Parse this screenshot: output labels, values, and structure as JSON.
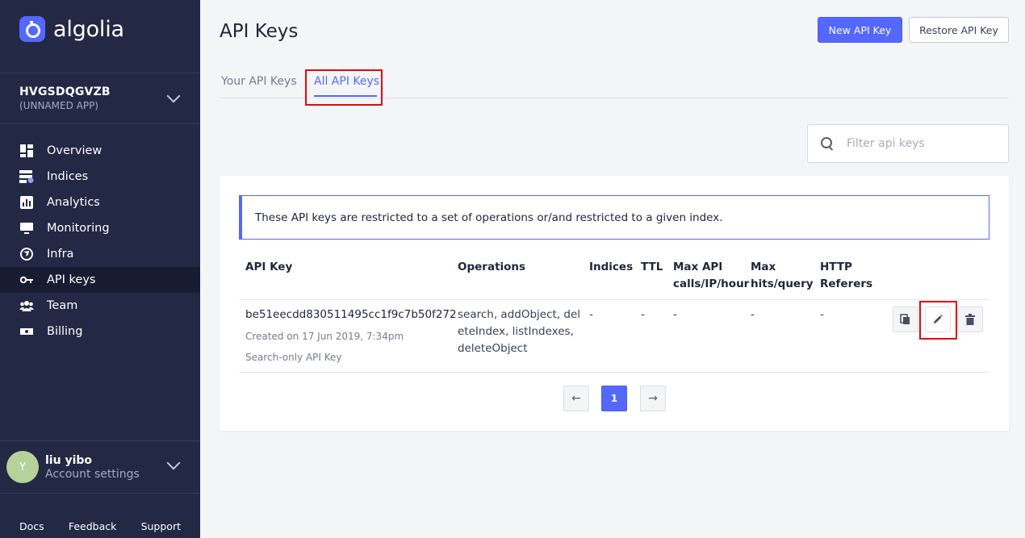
{
  "brand": {
    "name": "algolia",
    "accent": "#5468ff",
    "sidebar_bg": "#232844"
  },
  "app": {
    "id": "HVGSDQGVZB",
    "name": "(UNNAMED APP)"
  },
  "nav": [
    {
      "label": "Overview",
      "icon": "overview-icon"
    },
    {
      "label": "Indices",
      "icon": "indices-icon"
    },
    {
      "label": "Analytics",
      "icon": "analytics-icon"
    },
    {
      "label": "Monitoring",
      "icon": "monitoring-icon"
    },
    {
      "label": "Infra",
      "icon": "infra-icon"
    },
    {
      "label": "API keys",
      "icon": "key-icon",
      "active": true
    },
    {
      "label": "Team",
      "icon": "team-icon"
    },
    {
      "label": "Billing",
      "icon": "billing-icon"
    }
  ],
  "user": {
    "initial": "Y",
    "name": "liu yibo",
    "subtitle": "Account settings"
  },
  "footer": {
    "docs": "Docs",
    "feedback": "Feedback",
    "support": "Support"
  },
  "page": {
    "title": "API Keys",
    "new_key_label": "New API Key",
    "restore_key_label": "Restore API Key",
    "tabs": [
      "Your API Keys",
      "All API Keys"
    ],
    "active_tab": 1
  },
  "search": {
    "placeholder": "Filter api keys"
  },
  "notice": "These API keys are restricted to a set of operations or/and restricted to a given index.",
  "table": {
    "headers": {
      "api_key": "API Key",
      "operations": "Operations",
      "indices": "Indices",
      "ttl": "TTL",
      "max_api_1": "Max API",
      "max_api_2": "calls/IP/hour",
      "max_hits_1": "Max",
      "max_hits_2": "hits/query",
      "http_1": "HTTP",
      "http_2": "Referers"
    },
    "rows": [
      {
        "key": "be51eecdd830511495cc1f9c7b50f272",
        "created": "Created on 17 Jun 2019, 7:34pm",
        "description": "Search-only API Key",
        "operations_1": "search, addObject, del",
        "operations_2": "eteIndex, listIndexes,",
        "operations_3": "deleteObject",
        "indices": "-",
        "ttl": "-",
        "max_api": "-",
        "max_hits": "-",
        "referers": "-"
      }
    ]
  },
  "pagination": {
    "prev": "←",
    "current": "1",
    "next": "→"
  }
}
